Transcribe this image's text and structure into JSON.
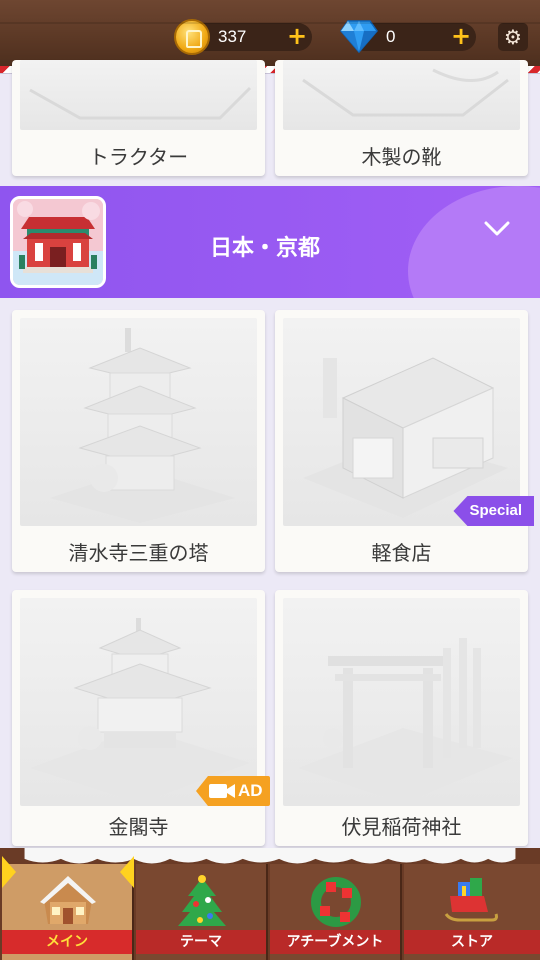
{
  "header": {
    "coins": "337",
    "gems": "0",
    "coin_icon": "coin-icon",
    "gem_icon": "diamond-icon",
    "settings_icon": "gear-icon",
    "plus_symbol": "+"
  },
  "top_cards": [
    "トラクター",
    "木製の靴"
  ],
  "category": {
    "title": "日本・京都",
    "expand_icon": "chevron-down-icon"
  },
  "cards": [
    {
      "label": "清水寺三重の塔"
    },
    {
      "label": "軽食店",
      "badge": "Special"
    },
    {
      "label": "金閣寺",
      "badge": "AD"
    },
    {
      "label": "伏見稲荷神社"
    }
  ],
  "nav": {
    "tabs": [
      {
        "label": "メイン",
        "icon": "house-icon",
        "active": true
      },
      {
        "label": "テーマ",
        "icon": "christmas-tree-icon",
        "active": false
      },
      {
        "label": "アチーブメント",
        "icon": "wreath-icon",
        "active": false
      },
      {
        "label": "ストア",
        "icon": "sleigh-icon",
        "active": false
      }
    ]
  },
  "colors": {
    "banner": "#9b5cf3",
    "special_badge": "#8b4fe9",
    "ad_badge": "#f5a121",
    "nav_label": "#b92a28",
    "active_label_text": "#ffdf3b"
  }
}
